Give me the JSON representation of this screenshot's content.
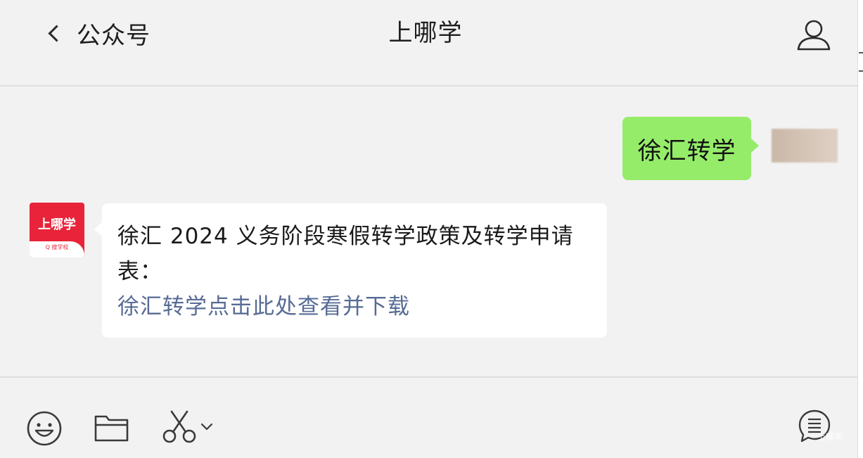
{
  "header": {
    "back_label": "公众号",
    "title": "上哪学"
  },
  "messages": {
    "outgoing": {
      "text": "徐汇转学"
    },
    "incoming": {
      "sender_logo_text": "上哪学",
      "sender_logo_subtext": "Q 搜学校",
      "text": "徐汇 2024 义务阶段寒假转学政策及转学申请表：",
      "link_text": "徐汇转学点击此处查看并下载"
    }
  },
  "watermark": "上哪学",
  "colors": {
    "outgoing_bubble": "#95ec69",
    "incoming_bubble": "#ffffff",
    "link": "#576b95",
    "brand": "#e8233a",
    "background": "#f2f2f2"
  },
  "toolbar": {
    "icons": [
      "emoji-icon",
      "folder-icon",
      "scissors-icon",
      "chevron-down-icon",
      "chat-history-icon"
    ]
  }
}
